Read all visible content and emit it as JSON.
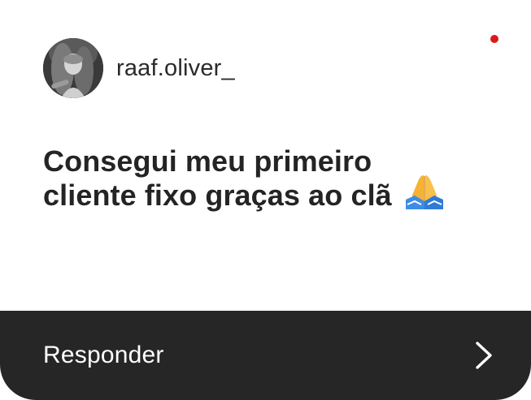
{
  "header": {
    "username": "raaf.oliver_",
    "avatar_icon": "user-photo-avatar"
  },
  "unread_indicator": {
    "color": "#e0161b"
  },
  "message": {
    "line1": "Consegui meu primeiro",
    "line2": "cliente fixo graças ao clã",
    "emoji": "folded-hands-icon"
  },
  "reply": {
    "label": "Responder",
    "icon": "chevron-right-icon"
  },
  "colors": {
    "background": "#ffffff",
    "reply_bar": "#262626",
    "text": "#242424",
    "emoji_skin": "#f7b236",
    "emoji_sleeve": "#3d8de6"
  }
}
